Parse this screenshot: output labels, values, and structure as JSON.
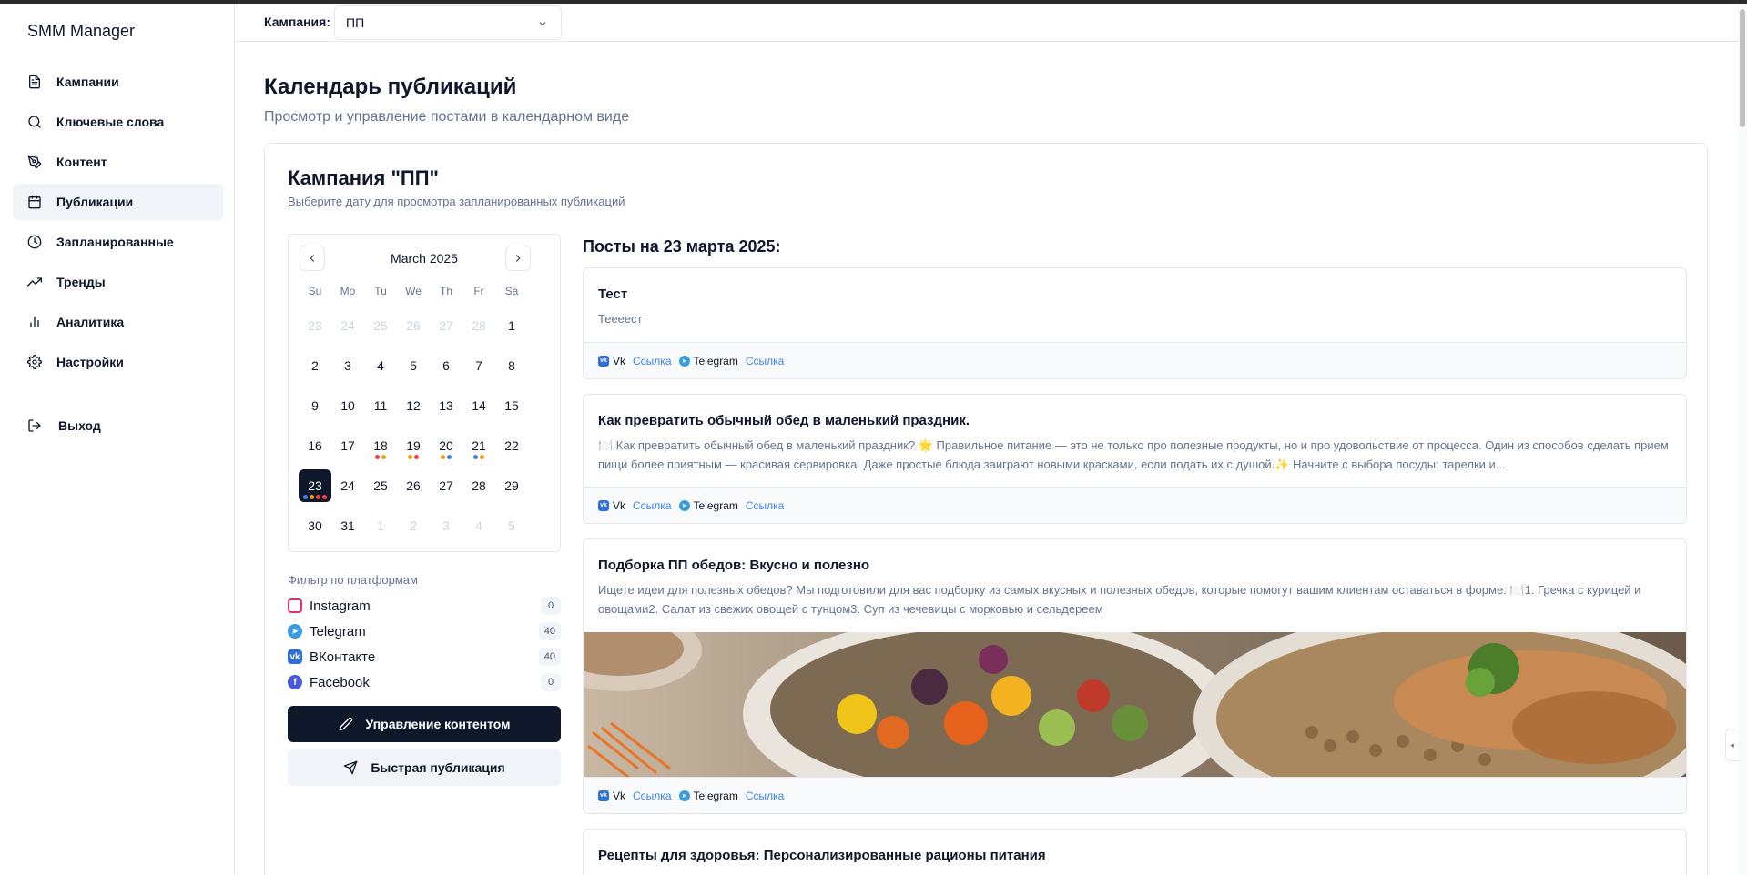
{
  "app": {
    "title": "SMM Manager"
  },
  "sidebar": {
    "items": [
      {
        "label": "Кампании",
        "icon": "file-icon"
      },
      {
        "label": "Ключевые слова",
        "icon": "search-icon"
      },
      {
        "label": "Контент",
        "icon": "pen-tool-icon"
      },
      {
        "label": "Публикации",
        "icon": "calendar-icon",
        "active": true
      },
      {
        "label": "Запланированные",
        "icon": "clock-icon"
      },
      {
        "label": "Тренды",
        "icon": "trending-up-icon"
      },
      {
        "label": "Аналитика",
        "icon": "bar-chart-icon"
      },
      {
        "label": "Настройки",
        "icon": "gear-icon"
      }
    ],
    "logout_label": "Выход"
  },
  "topbar": {
    "campaign_label": "Кампания:",
    "campaign_value": "ПП"
  },
  "header": {
    "title": "Календарь публикаций",
    "subtitle": "Просмотр и управление постами в календарном виде"
  },
  "card": {
    "title": "Кампания \"ПП\"",
    "subtitle": "Выберите дату для просмотра запланированных публикаций"
  },
  "calendar": {
    "month_label": "March 2025",
    "weekdays": [
      "Su",
      "Mo",
      "Tu",
      "We",
      "Th",
      "Fr",
      "Sa"
    ],
    "weeks": [
      [
        {
          "d": "23",
          "out": true
        },
        {
          "d": "24",
          "out": true
        },
        {
          "d": "25",
          "out": true
        },
        {
          "d": "26",
          "out": true
        },
        {
          "d": "27",
          "out": true
        },
        {
          "d": "28",
          "out": true
        },
        {
          "d": "1"
        }
      ],
      [
        {
          "d": "2"
        },
        {
          "d": "3"
        },
        {
          "d": "4"
        },
        {
          "d": "5"
        },
        {
          "d": "6"
        },
        {
          "d": "7"
        },
        {
          "d": "8"
        }
      ],
      [
        {
          "d": "9"
        },
        {
          "d": "10"
        },
        {
          "d": "11"
        },
        {
          "d": "12"
        },
        {
          "d": "13"
        },
        {
          "d": "14"
        },
        {
          "d": "15"
        }
      ],
      [
        {
          "d": "16"
        },
        {
          "d": "17"
        },
        {
          "d": "18",
          "dots": [
            "#ef4444",
            "#f59e0b"
          ]
        },
        {
          "d": "19",
          "dots": [
            "#f59e0b",
            "#ef4444"
          ]
        },
        {
          "d": "20",
          "dots": [
            "#f59e0b",
            "#3b82f6"
          ]
        },
        {
          "d": "21",
          "dots": [
            "#3b82f6",
            "#f59e0b"
          ]
        },
        {
          "d": "22"
        }
      ],
      [
        {
          "d": "23",
          "sel": true,
          "dots": [
            "#3b82f6",
            "#f59e0b",
            "#ef4444",
            "#ef4444"
          ]
        },
        {
          "d": "24"
        },
        {
          "d": "25"
        },
        {
          "d": "26"
        },
        {
          "d": "27"
        },
        {
          "d": "28"
        },
        {
          "d": "29"
        }
      ],
      [
        {
          "d": "30"
        },
        {
          "d": "31"
        },
        {
          "d": "1",
          "out": true
        },
        {
          "d": "2",
          "out": true
        },
        {
          "d": "3",
          "out": true
        },
        {
          "d": "4",
          "out": true
        },
        {
          "d": "5",
          "out": true
        }
      ]
    ]
  },
  "filter": {
    "title": "Фильтр по платформам",
    "platforms": [
      {
        "name": "Instagram",
        "count": "0",
        "color": "#e1306c",
        "icon": "instagram-icon"
      },
      {
        "name": "Telegram",
        "count": "40",
        "color": "#3b9ae1",
        "icon": "telegram-icon"
      },
      {
        "name": "ВКонтакте",
        "count": "40",
        "color": "#2f6fd6",
        "icon": "vk-icon"
      },
      {
        "name": "Facebook",
        "count": "0",
        "color": "#4858d6",
        "icon": "facebook-icon"
      }
    ]
  },
  "actions": {
    "manage_label": "Управление контентом",
    "quick_label": "Быстрая публикация"
  },
  "posts": {
    "heading": "Посты на 23 марта 2025:",
    "vk_label": "Vk",
    "tg_label": "Telegram",
    "link_label": "Ссылка",
    "items": [
      {
        "title": "Тест",
        "text": "Теееест"
      },
      {
        "title": "Как превратить обычный обед в маленький праздник.",
        "text": "🍽️ Как превратить обычный обед в маленький праздник? 🌟 Правильное питание — это не только про полезные продукты, но и про удовольствие от процесса. Один из способов сделать прием пищи более приятным — красивая сервировка. Даже простые блюда заиграют новыми красками, если подать их с душой.✨ Начните с выбора посуды: тарелки и..."
      },
      {
        "title": "Подборка ПП обедов: Вкусно и полезно",
        "text": "Ищете идеи для полезных обедов? Мы подготовили для вас подборку из самых вкусных и полезных обедов, которые помогут вашим клиентам оставаться в форме. 🍽️1. Гречка с курицей и овощами2. Салат из свежих овощей с тунцом3. Суп из чечевицы с морковью и сельдереем"
      },
      {
        "title": "Рецепты для здоровья: Персонализированные рационы питания",
        "text": ""
      }
    ]
  },
  "colors": {
    "accent": "#0f172a",
    "link": "#3b82f6",
    "vk": "#2f6fd6",
    "tg": "#3b9ae1"
  }
}
